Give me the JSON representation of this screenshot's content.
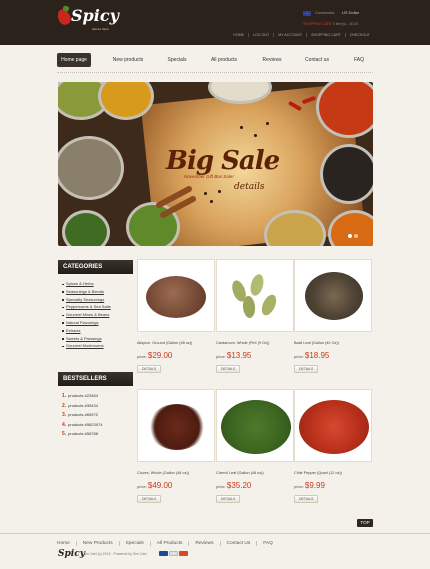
{
  "brand": {
    "name": "Spicy",
    "tagline": "Spices Store"
  },
  "header": {
    "currency_label": "Currencies",
    "currency_value": "US Dollar",
    "cart_label": "SHOPPING CART",
    "cart_summary": "0 item(s) - $0.00",
    "links": [
      "HOME",
      "LOG OUT",
      "MY ACCOUNT",
      "SHOPPING CART",
      "CHECKOUT"
    ]
  },
  "nav": {
    "items": [
      "Home page",
      "New products",
      "Specials",
      "All products",
      "Reviews",
      "Contact us",
      "FAQ"
    ],
    "active_index": 0
  },
  "banner": {
    "title": "Big Sale",
    "subtitle": "November Gift Box Sale!",
    "details": "details"
  },
  "sidebar": {
    "categories_title": "CATEGORIES",
    "categories": [
      "Spices & Herbs",
      "Seasonings & Blends",
      "Specialty Seasonings",
      "Peppercorns & Sea Salts",
      "Gourmet Mixes & Beans",
      "Natural Flavorings",
      "Extracts",
      "Sweets & Pressings",
      "Gourmet Mushrooms"
    ],
    "bestsellers_title": "BESTSELLERS",
    "bestsellers": [
      {
        "num": "1.",
        "label": "products #23454"
      },
      {
        "num": "2.",
        "label": "products #35434"
      },
      {
        "num": "3.",
        "label": "products #65972"
      },
      {
        "num": "4.",
        "label": "products #5623974"
      },
      {
        "num": "5.",
        "label": "products #56788"
      }
    ]
  },
  "products": [
    {
      "name": "Allspice, Ground (Gallon (48 oz))",
      "price_label": "price:",
      "price": "$29.00",
      "details": "DETAILS",
      "old_price": ""
    },
    {
      "name": "Cardamom, Whole (Pint (9 Oz))",
      "price_label": "price:",
      "price": "$13.95",
      "details": "DETAILS",
      "old_price": ""
    },
    {
      "name": "Basil Leaf (Gallon (40 Oz))",
      "price_label": "price:",
      "price": "$18.95",
      "details": "DETAILS",
      "old_price": ""
    },
    {
      "name": "Cloves, Whole (Gallon (48 oz))",
      "price_label": "price:",
      "price": "$49.00",
      "details": "DETAILS",
      "old_price": ""
    },
    {
      "name": "Chervil Leaf (Gallon (48 oz))",
      "price_label": "price:",
      "price": "$35.20",
      "details": "DETAILS",
      "old_price": ""
    },
    {
      "name": "Chile Pepper (Quart (12 oz))",
      "price_label": "price:",
      "price": "$9.99",
      "details": "DETAILS",
      "old_price": ""
    }
  ],
  "footer": {
    "top": "TOP",
    "links": [
      "Home",
      "New Products",
      "Specials",
      "All Products",
      "Reviews",
      "Contact Us",
      "FAQ"
    ],
    "logo": "Spicy",
    "copyright": "Zen Cart (c) 2013 · Powered by Zen Cart"
  },
  "colors": {
    "accent": "#d0381f",
    "header_bg": "#2b221c",
    "page_bg": "#f3f1ea"
  }
}
